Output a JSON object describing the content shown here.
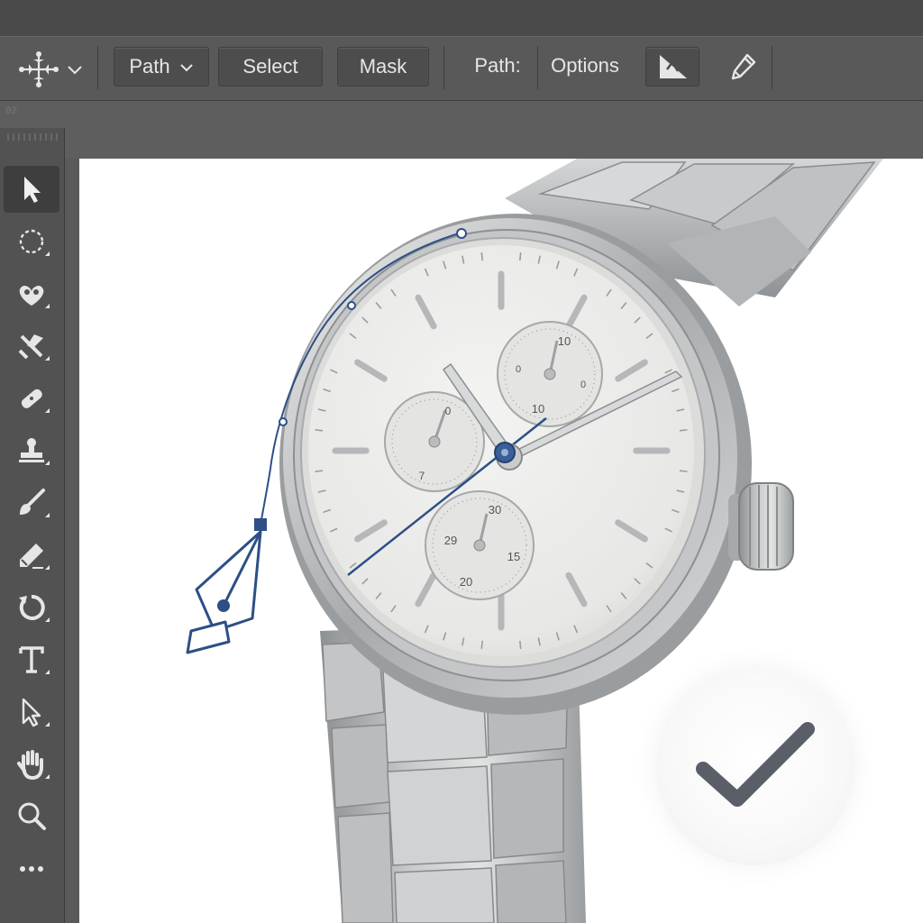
{
  "options_bar": {
    "move_tool_icon": "move-arrows-icon",
    "mode_dropdown": "Path",
    "select_button": "Select",
    "mask_button": "Mask",
    "path_label": "Path:",
    "options_label": "Options",
    "path_ops_icon": "path-operations-icon",
    "eyedropper_icon": "eyedropper-icon"
  },
  "document": {
    "tab_label": "02"
  },
  "toolbar": {
    "tools": [
      {
        "name": "selection-arrow-icon",
        "active": true
      },
      {
        "name": "elliptical-marquee-icon"
      },
      {
        "name": "quick-selection-icon"
      },
      {
        "name": "crop-slice-icon"
      },
      {
        "name": "healing-brush-icon"
      },
      {
        "name": "stamp-icon"
      },
      {
        "name": "brush-icon"
      },
      {
        "name": "pen-eraser-icon"
      },
      {
        "name": "history-rotate-icon"
      },
      {
        "name": "type-icon"
      },
      {
        "name": "direct-selection-icon"
      },
      {
        "name": "hand-icon"
      },
      {
        "name": "zoom-icon"
      },
      {
        "name": "more-tools-icon"
      }
    ]
  },
  "watch": {
    "subdial_top_numbers": [
      "10",
      "10",
      "0",
      "0"
    ],
    "subdial_left_numbers": [
      "0",
      "7"
    ],
    "subdial_bottom_numbers": [
      "30",
      "29",
      "15",
      "20"
    ]
  },
  "colors": {
    "path_blue": "#2d4f86",
    "canvas": "#ffffff",
    "ui_dark": "#535353",
    "checkmark": "#5a5e66"
  }
}
